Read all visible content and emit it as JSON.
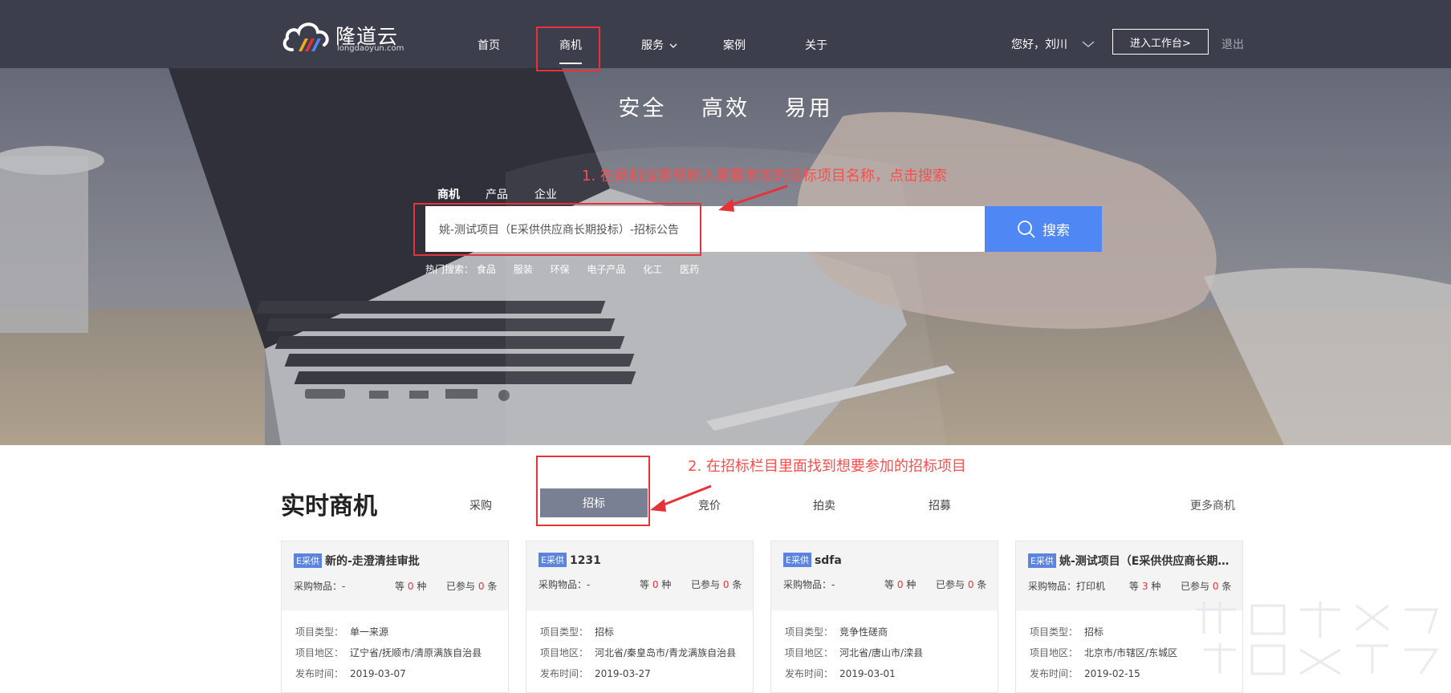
{
  "header": {
    "logo_text": "隆道云",
    "logo_domain": "longdaoyun.com",
    "nav": [
      "首页",
      "商机",
      "服务",
      "案例",
      "关于"
    ],
    "active_nav": "商机",
    "greeting": "您好，刘川",
    "workbench_label": "进入工作台>",
    "logout_label": "退出"
  },
  "hero": {
    "tagline": [
      "安全",
      "高效",
      "易用"
    ],
    "annotation_1": "1. 在商机搜索框输入需要参加的招标项目名称，点击搜索",
    "search_tabs": [
      "商机",
      "产品",
      "企业"
    ],
    "search_value": "姚-测试项目（E采供供应商长期投标）-招标公告",
    "search_button": "搜索",
    "hot_label": "热门搜索：",
    "hot_terms": [
      "食品",
      "服装",
      "环保",
      "电子产品",
      "化工",
      "医药"
    ]
  },
  "realtime": {
    "title": "实时商机",
    "annotation_2": "2. 在招标栏目里面找到想要参加的招标项目",
    "tabs": [
      "采购",
      "招标",
      "竞价",
      "拍卖",
      "招募"
    ],
    "active_tab": "招标",
    "more": "更多商机",
    "labels": {
      "goods": "采购物品：",
      "equal": "等",
      "kinds": "种",
      "joined": "已参与",
      "items": "条",
      "type": "项目类型：",
      "region": "项目地区：",
      "date": "发布时间："
    },
    "cards": [
      {
        "badge": "E采供",
        "title": "新的-走澄清挂审批",
        "goods": "-",
        "kinds": "0",
        "joined": "0",
        "type": "单一来源",
        "region": "辽宁省/抚顺市/清原满族自治县",
        "date": "2019-03-07"
      },
      {
        "badge": "E采供",
        "title": "1231",
        "goods": "-",
        "kinds": "0",
        "joined": "0",
        "type": "招标",
        "region": "河北省/秦皇岛市/青龙满族自治县",
        "date": "2019-03-27"
      },
      {
        "badge": "E采供",
        "title": "sdfa",
        "goods": "-",
        "kinds": "0",
        "joined": "0",
        "type": "竞争性磋商",
        "region": "河北省/唐山市/滦县",
        "date": "2019-03-01"
      },
      {
        "badge": "E采供",
        "title": "姚-测试项目（E采供供应商长期...",
        "goods": "打印机",
        "kinds": "3",
        "joined": "0",
        "type": "招标",
        "region": "北京市/市辖区/东城区",
        "date": "2019-02-15"
      }
    ]
  },
  "colors": {
    "nav_bg": "#3d3e4b",
    "search_button": "#4f88f5",
    "highlight": "#e8323a",
    "active_tab_bg": "#7a8094"
  }
}
